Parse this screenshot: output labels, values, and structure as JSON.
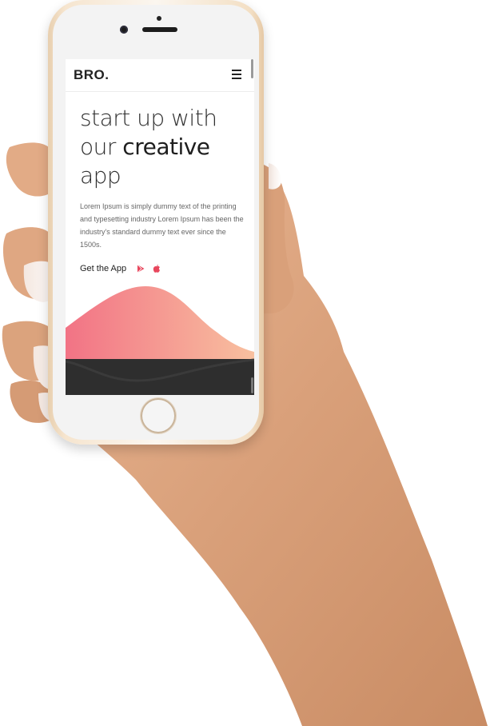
{
  "app": {
    "logo": "BRO.",
    "hero_line1": "start up with",
    "hero_line2_a": "our ",
    "hero_line2_b": "creative",
    "hero_line3": "app",
    "description": "Lorem Ipsum is simply dummy text of the printing and typesetting industry Lorem Ipsum has been the industry's standard dummy text ever since the 1500s.",
    "cta_label": "Get the App",
    "icons": {
      "menu": "hamburger-menu-icon",
      "play_store": "google-play-icon",
      "app_store": "apple-icon"
    }
  },
  "colors": {
    "accent": "#e8475d",
    "wave_start": "#f27385",
    "wave_end": "#f8c09f",
    "footer": "#2e2e2e"
  }
}
